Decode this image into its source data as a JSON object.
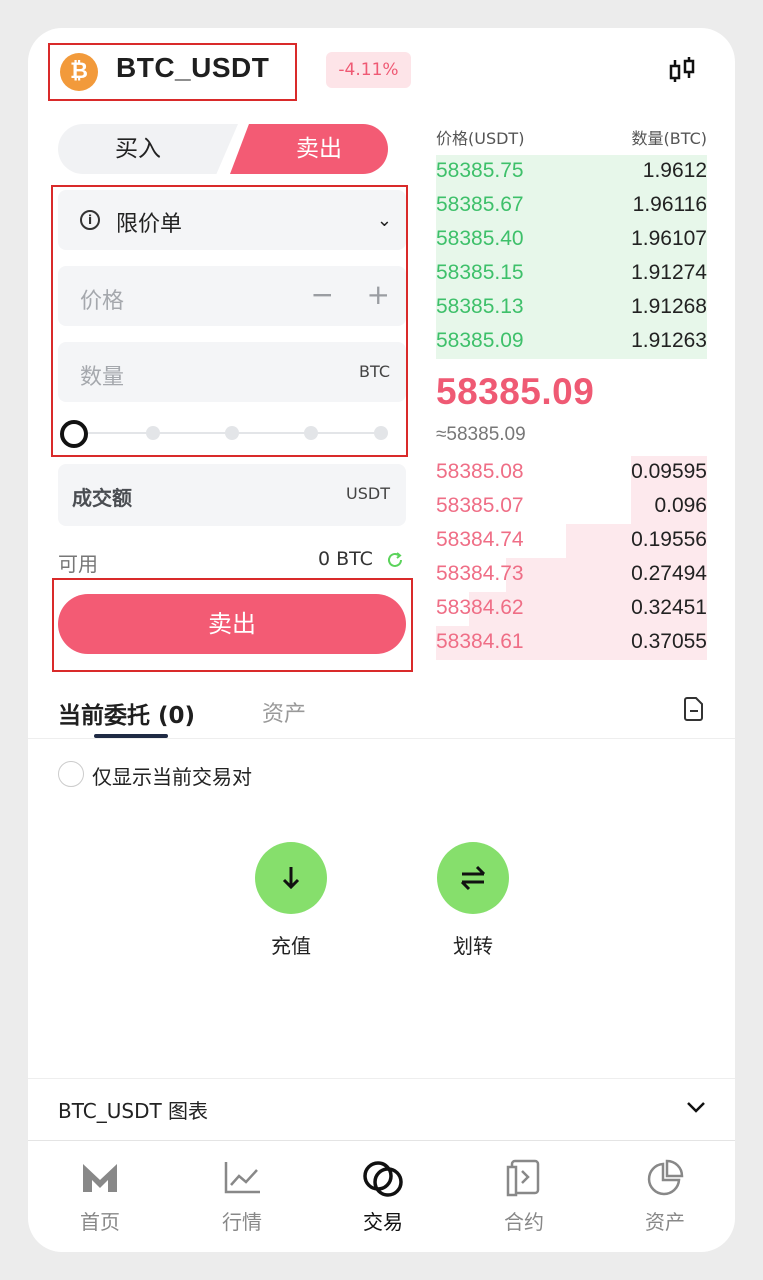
{
  "header": {
    "pair": "BTC_USDT",
    "coin_logo": "₿",
    "change": "-4.11%"
  },
  "trade": {
    "buy_tab": "买入",
    "sell_tab": "卖出",
    "order_type": "限价单",
    "price_placeholder": "价格",
    "minus": "−",
    "plus": "+",
    "qty_placeholder": "数量",
    "qty_unit": "BTC",
    "total_label": "成交额",
    "total_unit": "USDT",
    "available_label": "可用",
    "available_value": "0 BTC",
    "submit": "卖出",
    "slider_percent": 0
  },
  "orderbook": {
    "price_header": "价格(USDT)",
    "qty_header": "数量(BTC)",
    "bids": [
      {
        "price": "58385.75",
        "qty": "1.9612"
      },
      {
        "price": "58385.67",
        "qty": "1.96116"
      },
      {
        "price": "58385.40",
        "qty": "1.96107"
      },
      {
        "price": "58385.15",
        "qty": "1.91274"
      },
      {
        "price": "58385.13",
        "qty": "1.91268"
      },
      {
        "price": "58385.09",
        "qty": "1.91263"
      }
    ],
    "last_price": "58385.09",
    "approx_price": "≈58385.09",
    "asks": [
      {
        "price": "58385.08",
        "qty": "0.09595"
      },
      {
        "price": "58385.07",
        "qty": "0.096"
      },
      {
        "price": "58384.74",
        "qty": "0.19556"
      },
      {
        "price": "58384.73",
        "qty": "0.27494"
      },
      {
        "price": "58384.62",
        "qty": "0.32451"
      },
      {
        "price": "58384.61",
        "qty": "0.37055"
      }
    ]
  },
  "orders": {
    "tab_current": "当前委托 (0)",
    "tab_assets": "资产",
    "filter_label": "仅显示当前交易对",
    "deposit": "充值",
    "transfer": "划转"
  },
  "chart_bar": {
    "label": "BTC_USDT 图表"
  },
  "nav": {
    "home": "首页",
    "market": "行情",
    "trade": "交易",
    "contract": "合约",
    "assets": "资产"
  },
  "colors": {
    "sell": "#f35b74",
    "bid": "#3ec06a",
    "ask": "#ef6e86",
    "action": "#86df6c",
    "highlight": "#d92a2a"
  }
}
